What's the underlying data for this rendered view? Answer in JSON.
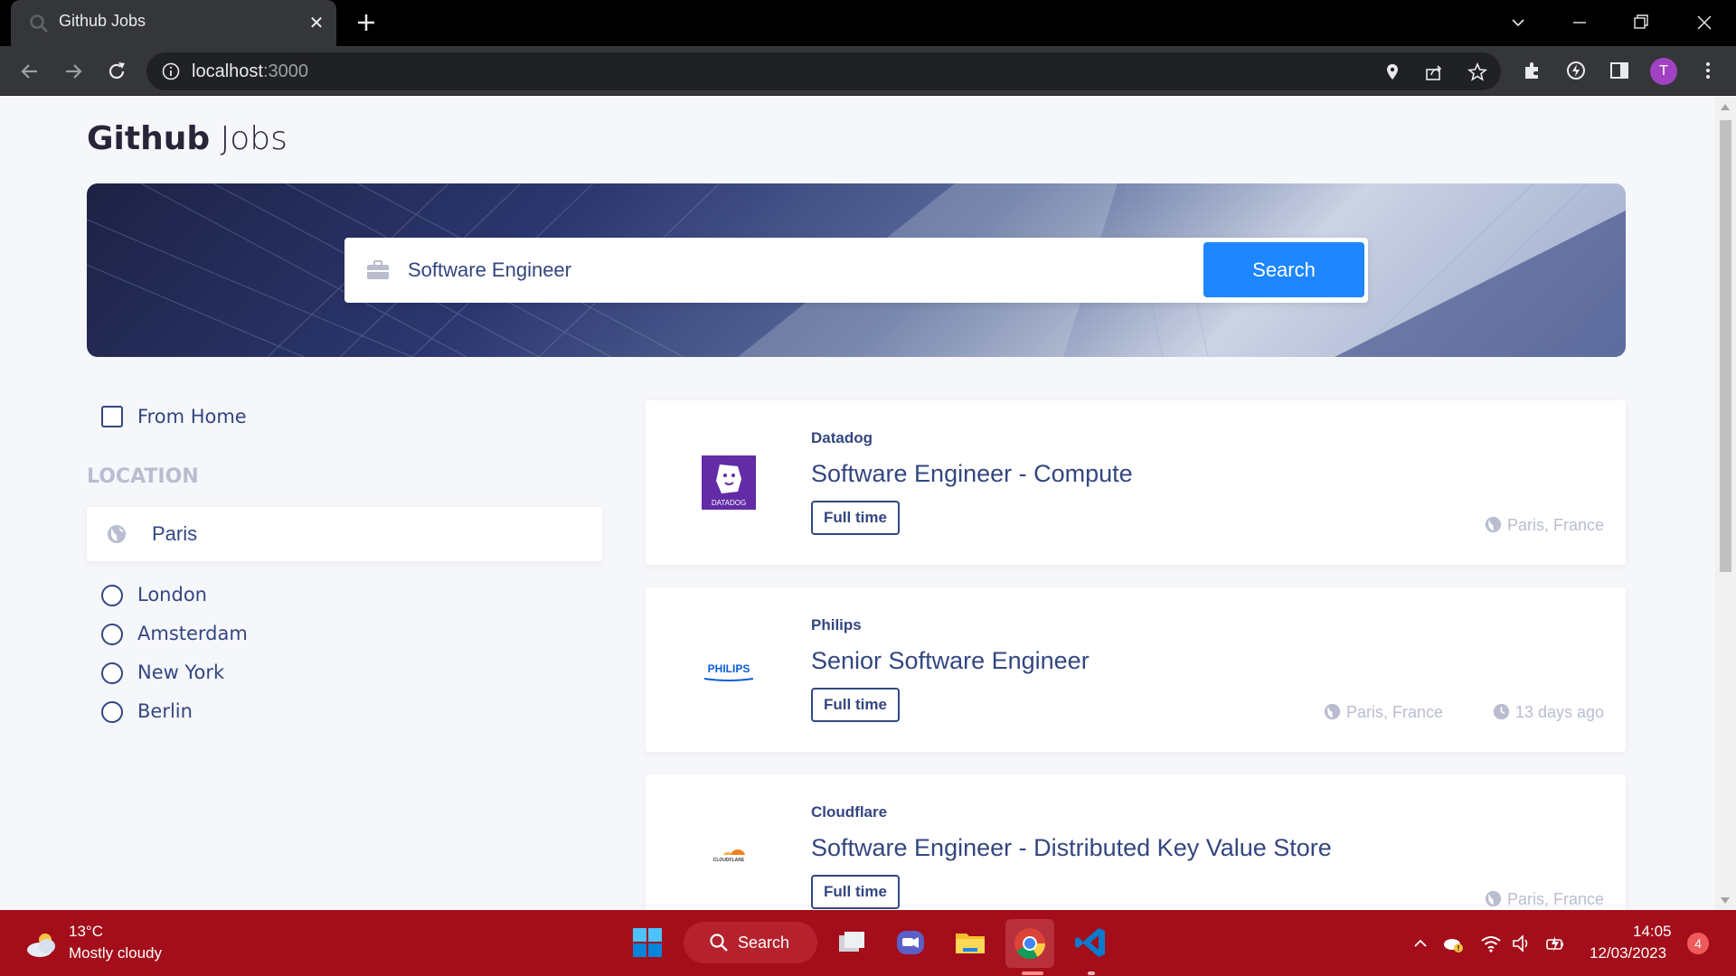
{
  "browser": {
    "tab_title": "Github Jobs",
    "url_host": "localhost",
    "url_port": ":3000",
    "profile_initial": "T",
    "accent": "#a142c5"
  },
  "site": {
    "title_bold": "Github",
    "title_light": "Jobs"
  },
  "search": {
    "value": "Software Engineer",
    "button_label": "Search",
    "button_color": "#1e86ff"
  },
  "filters": {
    "from_home_label": "From Home",
    "location_heading": "LOCATION",
    "location_value": "Paris",
    "cities": [
      "London",
      "Amsterdam",
      "New York",
      "Berlin"
    ]
  },
  "jobs": [
    {
      "company": "Datadog",
      "title": "Software Engineer - Compute",
      "type": "Full time",
      "location": "Paris, France",
      "posted": ""
    },
    {
      "company": "Philips",
      "title": "Senior Software Engineer",
      "type": "Full time",
      "location": "Paris, France",
      "posted": "13 days ago"
    },
    {
      "company": "Cloudflare",
      "title": "Software Engineer - Distributed Key Value Store",
      "type": "Full time",
      "location": "Paris, France",
      "posted": ""
    }
  ],
  "logos": {
    "datadog_text": "DATADOG",
    "philips_text": "PHILIPS",
    "cloudflare_text": "CLOUDFLARE"
  },
  "taskbar": {
    "temp": "13°C",
    "weather": "Mostly cloudy",
    "search_label": "Search",
    "time": "14:05",
    "date": "12/03/2023",
    "notifications": "4",
    "bar_color": "#a30e1a"
  }
}
